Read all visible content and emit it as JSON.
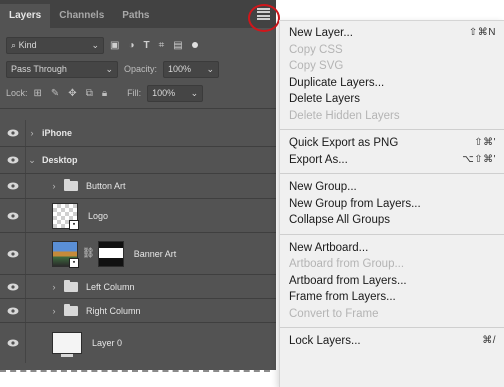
{
  "tabs": [
    "Layers",
    "Channels",
    "Paths"
  ],
  "filter": {
    "kind_label": "Kind",
    "icons": [
      "pixel-filter-icon",
      "adjustment-filter-icon",
      "type-filter-icon",
      "shape-filter-icon",
      "smart-object-filter-icon"
    ]
  },
  "blend": {
    "mode": "Pass Through",
    "opacity_label": "Opacity:",
    "opacity_value": "100%"
  },
  "lock": {
    "label": "Lock:",
    "fill_label": "Fill:",
    "fill_value": "100%"
  },
  "layers": [
    {
      "name": "iPhone",
      "type": "artboard"
    },
    {
      "name": "Desktop",
      "type": "artboard"
    },
    {
      "name": "Button Art",
      "type": "group"
    },
    {
      "name": "Logo",
      "type": "smart-object"
    },
    {
      "name": "Banner Art",
      "type": "masked-smart-object"
    },
    {
      "name": "Left Column",
      "type": "group"
    },
    {
      "name": "Right Column",
      "type": "group"
    },
    {
      "name": "Layer 0",
      "type": "artboard-layer"
    }
  ],
  "menu": {
    "g1": [
      {
        "label": "New Layer...",
        "shortcut": "⇧⌘N",
        "enabled": true
      },
      {
        "label": "Copy CSS",
        "shortcut": "",
        "enabled": false
      },
      {
        "label": "Copy SVG",
        "shortcut": "",
        "enabled": false
      },
      {
        "label": "Duplicate Layers...",
        "shortcut": "",
        "enabled": true
      },
      {
        "label": "Delete Layers",
        "shortcut": "",
        "enabled": true
      },
      {
        "label": "Delete Hidden Layers",
        "shortcut": "",
        "enabled": false
      }
    ],
    "g2": [
      {
        "label": "Quick Export as PNG",
        "shortcut": "⇧⌘'",
        "enabled": true
      },
      {
        "label": "Export As...",
        "shortcut": "⌥⇧⌘'",
        "enabled": true
      }
    ],
    "g3": [
      {
        "label": "New Group...",
        "shortcut": "",
        "enabled": true
      },
      {
        "label": "New Group from Layers...",
        "shortcut": "",
        "enabled": true
      },
      {
        "label": "Collapse All Groups",
        "shortcut": "",
        "enabled": true
      }
    ],
    "g4": [
      {
        "label": "New Artboard...",
        "shortcut": "",
        "enabled": true
      },
      {
        "label": "Artboard from Group...",
        "shortcut": "",
        "enabled": false
      },
      {
        "label": "Artboard from Layers...",
        "shortcut": "",
        "enabled": true
      },
      {
        "label": "Frame from Layers...",
        "shortcut": "",
        "enabled": true
      },
      {
        "label": "Convert to Frame",
        "shortcut": "",
        "enabled": false
      }
    ],
    "g5": [
      {
        "label": "Lock Layers...",
        "shortcut": "⌘/",
        "enabled": true
      }
    ]
  },
  "colors": {
    "panel_bg": "#535353",
    "menu_bg": "#f0f0f0",
    "highlight_ring": "#d0161b"
  }
}
